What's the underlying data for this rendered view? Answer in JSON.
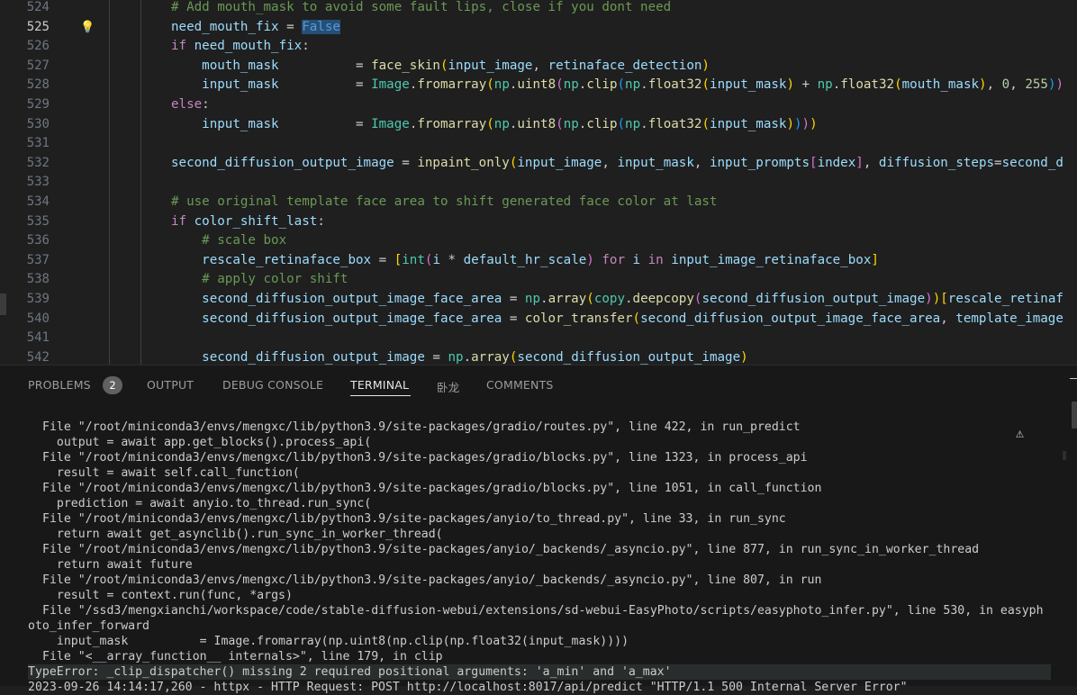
{
  "editor": {
    "lines": [
      {
        "num": "524",
        "segments": [
          {
            "t": "# Add mouth_mask to avoid some fault lips, close if you dont need",
            "c": "cm"
          }
        ]
      },
      {
        "num": "525",
        "current": true,
        "segments": [
          {
            "t": "need_mouth_fix",
            "c": "v"
          },
          {
            "t": " = ",
            "c": ""
          },
          {
            "t": "False",
            "c": "kw2 sel"
          }
        ]
      },
      {
        "num": "526",
        "segments": [
          {
            "t": "if",
            "c": "kw"
          },
          {
            "t": " ",
            "c": ""
          },
          {
            "t": "need_mouth_fix",
            "c": "v"
          },
          {
            "t": ":",
            "c": ""
          }
        ]
      },
      {
        "num": "527",
        "segments": [
          {
            "t": "    mouth_mask",
            "c": "v"
          },
          {
            "t": "          = ",
            "c": ""
          },
          {
            "t": "face_skin",
            "c": "fn"
          },
          {
            "t": "(",
            "c": "br1"
          },
          {
            "t": "input_image",
            "c": "v"
          },
          {
            "t": ", ",
            "c": ""
          },
          {
            "t": "retinaface_detection",
            "c": "v"
          },
          {
            "t": ")",
            "c": "br1"
          }
        ]
      },
      {
        "num": "528",
        "segments": [
          {
            "t": "    input_mask",
            "c": "v"
          },
          {
            "t": "          = ",
            "c": ""
          },
          {
            "t": "Image",
            "c": "cls"
          },
          {
            "t": ".",
            "c": ""
          },
          {
            "t": "fromarray",
            "c": "fn"
          },
          {
            "t": "(",
            "c": "br1"
          },
          {
            "t": "np",
            "c": "cls"
          },
          {
            "t": ".",
            "c": ""
          },
          {
            "t": "uint8",
            "c": "fn"
          },
          {
            "t": "(",
            "c": "br2"
          },
          {
            "t": "np",
            "c": "cls"
          },
          {
            "t": ".",
            "c": ""
          },
          {
            "t": "clip",
            "c": "fn"
          },
          {
            "t": "(",
            "c": "br3"
          },
          {
            "t": "np",
            "c": "cls"
          },
          {
            "t": ".",
            "c": ""
          },
          {
            "t": "float32",
            "c": "fn"
          },
          {
            "t": "(",
            "c": "br1"
          },
          {
            "t": "input_mask",
            "c": "v"
          },
          {
            "t": ")",
            "c": "br1"
          },
          {
            "t": " + ",
            "c": ""
          },
          {
            "t": "np",
            "c": "cls"
          },
          {
            "t": ".",
            "c": ""
          },
          {
            "t": "float32",
            "c": "fn"
          },
          {
            "t": "(",
            "c": "br1"
          },
          {
            "t": "mouth_mask",
            "c": "v"
          },
          {
            "t": ")",
            "c": "br1"
          },
          {
            "t": ", ",
            "c": ""
          },
          {
            "t": "0",
            "c": "num"
          },
          {
            "t": ", ",
            "c": ""
          },
          {
            "t": "255",
            "c": "num"
          },
          {
            "t": ")",
            "c": "br3"
          },
          {
            "t": ")",
            "c": "br2"
          }
        ]
      },
      {
        "num": "529",
        "segments": [
          {
            "t": "else",
            "c": "kw"
          },
          {
            "t": ":",
            "c": ""
          }
        ]
      },
      {
        "num": "530",
        "segments": [
          {
            "t": "    input_mask",
            "c": "v"
          },
          {
            "t": "          = ",
            "c": ""
          },
          {
            "t": "Image",
            "c": "cls"
          },
          {
            "t": ".",
            "c": ""
          },
          {
            "t": "fromarray",
            "c": "fn"
          },
          {
            "t": "(",
            "c": "br1"
          },
          {
            "t": "np",
            "c": "cls"
          },
          {
            "t": ".",
            "c": ""
          },
          {
            "t": "uint8",
            "c": "fn"
          },
          {
            "t": "(",
            "c": "br2"
          },
          {
            "t": "np",
            "c": "cls"
          },
          {
            "t": ".",
            "c": ""
          },
          {
            "t": "clip",
            "c": "fn"
          },
          {
            "t": "(",
            "c": "br3"
          },
          {
            "t": "np",
            "c": "cls"
          },
          {
            "t": ".",
            "c": ""
          },
          {
            "t": "float32",
            "c": "fn"
          },
          {
            "t": "(",
            "c": "br1"
          },
          {
            "t": "input_mask",
            "c": "v"
          },
          {
            "t": ")",
            "c": "br1"
          },
          {
            "t": ")",
            "c": "br3"
          },
          {
            "t": ")",
            "c": "br2"
          },
          {
            "t": ")",
            "c": "br1"
          }
        ]
      },
      {
        "num": "531",
        "segments": []
      },
      {
        "num": "532",
        "segments": [
          {
            "t": "second_diffusion_output_image",
            "c": "v"
          },
          {
            "t": " = ",
            "c": ""
          },
          {
            "t": "inpaint_only",
            "c": "fn"
          },
          {
            "t": "(",
            "c": "br1"
          },
          {
            "t": "input_image",
            "c": "v"
          },
          {
            "t": ", ",
            "c": ""
          },
          {
            "t": "input_mask",
            "c": "v"
          },
          {
            "t": ", ",
            "c": ""
          },
          {
            "t": "input_prompts",
            "c": "v"
          },
          {
            "t": "[",
            "c": "br2"
          },
          {
            "t": "index",
            "c": "v"
          },
          {
            "t": "]",
            "c": "br2"
          },
          {
            "t": ", ",
            "c": ""
          },
          {
            "t": "diffusion_steps",
            "c": "v"
          },
          {
            "t": "=",
            "c": ""
          },
          {
            "t": "second_d",
            "c": "v"
          }
        ]
      },
      {
        "num": "533",
        "segments": []
      },
      {
        "num": "534",
        "segments": [
          {
            "t": "# use original template face area to shift generated face color at last",
            "c": "cm"
          }
        ]
      },
      {
        "num": "535",
        "segments": [
          {
            "t": "if",
            "c": "kw"
          },
          {
            "t": " ",
            "c": ""
          },
          {
            "t": "color_shift_last",
            "c": "v"
          },
          {
            "t": ":",
            "c": ""
          }
        ]
      },
      {
        "num": "536",
        "segments": [
          {
            "t": "    # scale box",
            "c": "cm"
          }
        ]
      },
      {
        "num": "537",
        "segments": [
          {
            "t": "    rescale_retinaface_box",
            "c": "v"
          },
          {
            "t": " = ",
            "c": ""
          },
          {
            "t": "[",
            "c": "br1"
          },
          {
            "t": "int",
            "c": "cls"
          },
          {
            "t": "(",
            "c": "br2"
          },
          {
            "t": "i",
            "c": "v"
          },
          {
            "t": " * ",
            "c": ""
          },
          {
            "t": "default_hr_scale",
            "c": "v"
          },
          {
            "t": ")",
            "c": "br2"
          },
          {
            "t": " ",
            "c": ""
          },
          {
            "t": "for",
            "c": "kw"
          },
          {
            "t": " ",
            "c": ""
          },
          {
            "t": "i",
            "c": "v"
          },
          {
            "t": " ",
            "c": ""
          },
          {
            "t": "in",
            "c": "kw"
          },
          {
            "t": " ",
            "c": ""
          },
          {
            "t": "input_image_retinaface_box",
            "c": "v"
          },
          {
            "t": "]",
            "c": "br1"
          }
        ]
      },
      {
        "num": "538",
        "segments": [
          {
            "t": "    # apply color shift",
            "c": "cm"
          }
        ]
      },
      {
        "num": "539",
        "segments": [
          {
            "t": "    second_diffusion_output_image_face_area",
            "c": "v"
          },
          {
            "t": " = ",
            "c": ""
          },
          {
            "t": "np",
            "c": "cls"
          },
          {
            "t": ".",
            "c": ""
          },
          {
            "t": "array",
            "c": "fn"
          },
          {
            "t": "(",
            "c": "br1"
          },
          {
            "t": "copy",
            "c": "cls"
          },
          {
            "t": ".",
            "c": ""
          },
          {
            "t": "deepcopy",
            "c": "fn"
          },
          {
            "t": "(",
            "c": "br2"
          },
          {
            "t": "second_diffusion_output_image",
            "c": "v"
          },
          {
            "t": ")",
            "c": "br2"
          },
          {
            "t": ")",
            "c": "br1"
          },
          {
            "t": "[",
            "c": "br1"
          },
          {
            "t": "rescale_retinaf",
            "c": "v"
          }
        ]
      },
      {
        "num": "540",
        "segments": [
          {
            "t": "    second_diffusion_output_image_face_area",
            "c": "v"
          },
          {
            "t": " = ",
            "c": ""
          },
          {
            "t": "color_transfer",
            "c": "fn"
          },
          {
            "t": "(",
            "c": "br1"
          },
          {
            "t": "second_diffusion_output_image_face_area",
            "c": "v"
          },
          {
            "t": ", ",
            "c": ""
          },
          {
            "t": "template_image",
            "c": "v"
          }
        ]
      },
      {
        "num": "541",
        "segments": []
      },
      {
        "num": "542",
        "segments": [
          {
            "t": "    second_diffusion_output_image",
            "c": "v"
          },
          {
            "t": " = ",
            "c": ""
          },
          {
            "t": "np",
            "c": "cls"
          },
          {
            "t": ".",
            "c": ""
          },
          {
            "t": "array",
            "c": "fn"
          },
          {
            "t": "(",
            "c": "br1"
          },
          {
            "t": "second_diffusion_output_image",
            "c": "v"
          },
          {
            "t": ")",
            "c": "br1"
          }
        ]
      }
    ]
  },
  "panel": {
    "tabs": [
      {
        "label": "PROBLEMS",
        "name": "tab-problems"
      },
      {
        "label": "OUTPUT",
        "name": "tab-output"
      },
      {
        "label": "DEBUG CONSOLE",
        "name": "tab-debug-console"
      },
      {
        "label": "TERMINAL",
        "name": "tab-terminal",
        "active": true
      },
      {
        "label": "卧龙",
        "name": "tab-wolong"
      },
      {
        "label": "COMMENTS",
        "name": "tab-comments"
      }
    ],
    "problems_count": "2",
    "terminal_lines": [
      "File \"/root/miniconda3/envs/mengxc/lib/python3.9/site-packages/gradio/routes.py\", line 422, in run_predict",
      "  output = await app.get_blocks().process_api(",
      "File \"/root/miniconda3/envs/mengxc/lib/python3.9/site-packages/gradio/blocks.py\", line 1323, in process_api",
      "  result = await self.call_function(",
      "File \"/root/miniconda3/envs/mengxc/lib/python3.9/site-packages/gradio/blocks.py\", line 1051, in call_function",
      "  prediction = await anyio.to_thread.run_sync(",
      "File \"/root/miniconda3/envs/mengxc/lib/python3.9/site-packages/anyio/to_thread.py\", line 33, in run_sync",
      "  return await get_asynclib().run_sync_in_worker_thread(",
      "File \"/root/miniconda3/envs/mengxc/lib/python3.9/site-packages/anyio/_backends/_asyncio.py\", line 877, in run_sync_in_worker_thread",
      "  return await future",
      "File \"/root/miniconda3/envs/mengxc/lib/python3.9/site-packages/anyio/_backends/_asyncio.py\", line 807, in run",
      "  result = context.run(func, *args)",
      "File \"/ssd3/mengxianchi/workspace/code/stable-diffusion-webui/extensions/sd-webui-EasyPhoto/scripts/easyphoto_infer.py\", line 530, in easyph",
      "oto_infer_forward",
      "  input_mask          = Image.fromarray(np.uint8(np.clip(np.float32(input_mask))))",
      "File \"<__array_function__ internals>\", line 179, in clip",
      "TypeError: _clip_dispatcher() missing 2 required positional arguments: 'a_min' and 'a_max'",
      "2023-09-26 14:14:17,260 - httpx - HTTP Request: POST http://localhost:8017/api/predict \"HTTP/1.1 500 Internal Server Error\""
    ]
  }
}
